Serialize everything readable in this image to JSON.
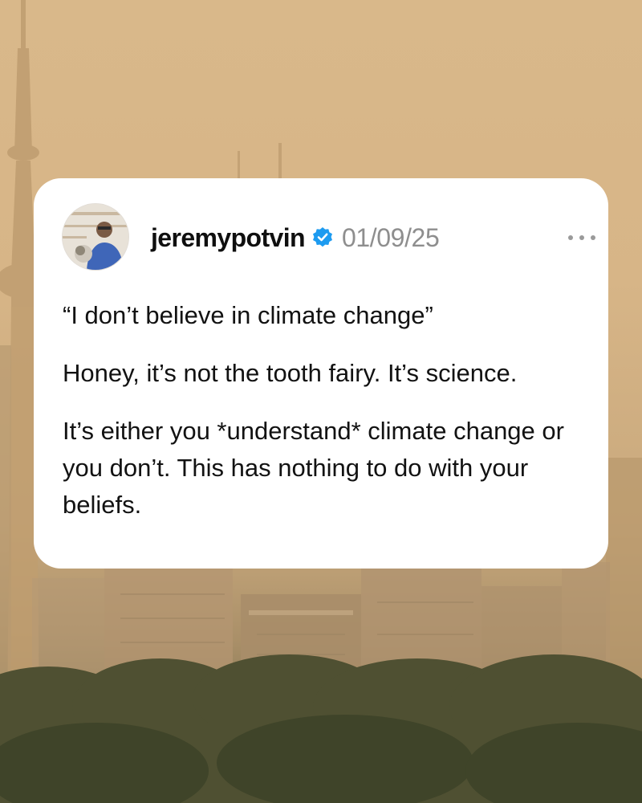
{
  "post": {
    "username": "jeremypotvin",
    "date": "01/09/25",
    "verified": true,
    "paragraphs": [
      "“I don’t believe in climate change”",
      "Honey, it’s not the tooth fairy. It’s science.",
      "It’s either you *understand* climate change or you don’t. This has nothing to do with your beliefs."
    ]
  },
  "icons": {
    "verified": "verified-badge-icon",
    "more": "more-options-icon"
  },
  "colors": {
    "background_haze": "#d9b88a",
    "card": "#ffffff",
    "verified_blue": "#1d9bf0",
    "date_gray": "#8e8e8e"
  }
}
